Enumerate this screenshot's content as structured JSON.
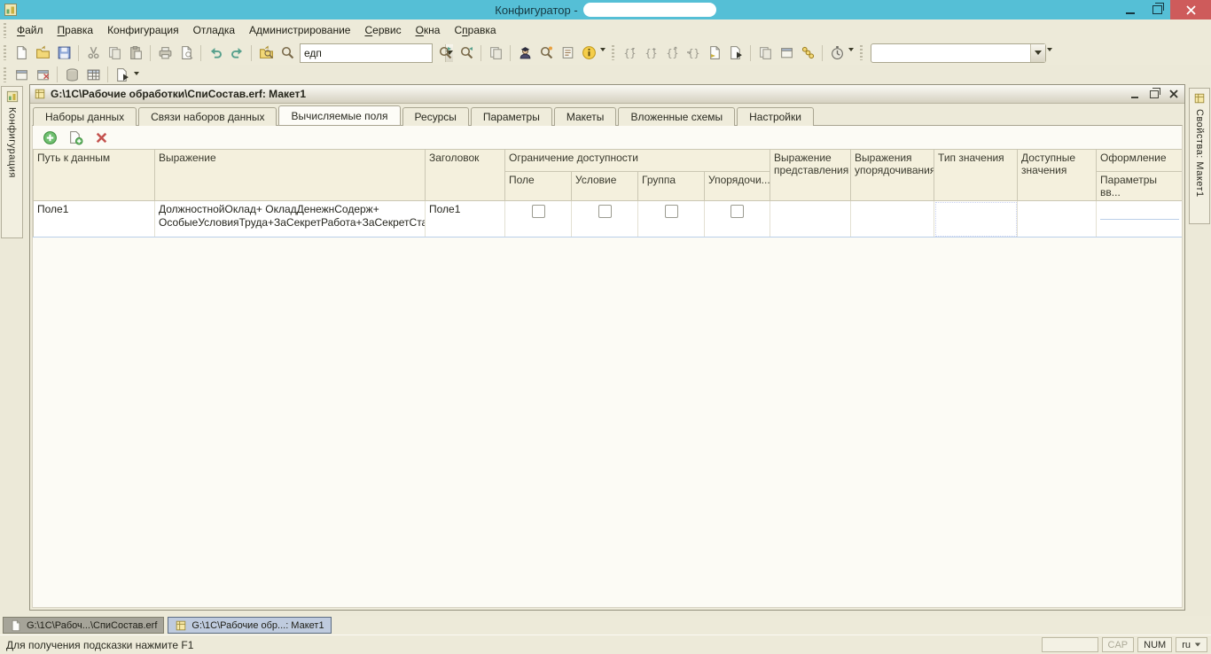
{
  "titlebar": {
    "title": "Конфигуратор -"
  },
  "menu": {
    "items": [
      {
        "label": "Файл",
        "accel": 0
      },
      {
        "label": "Правка",
        "accel": 0
      },
      {
        "label": "Конфигурация",
        "accel": -1
      },
      {
        "label": "Отладка",
        "accel": -1
      },
      {
        "label": "Администрирование",
        "accel": -1
      },
      {
        "label": "Сервис",
        "accel": 0
      },
      {
        "label": "Окна",
        "accel": 0
      },
      {
        "label": "Справка",
        "accel": 1
      }
    ]
  },
  "toolbar": {
    "search_value": "едп",
    "quick_select_value": "",
    "icons_row1": [
      "new-document",
      "open",
      "save",
      "cut",
      "copy",
      "paste",
      "print",
      "print-preview",
      "undo",
      "redo",
      "find-in-files",
      "search",
      "find-next",
      "find-previous",
      "clone-window",
      "syntax-check",
      "find-in-modules",
      "templates",
      "info",
      "step-braces-1",
      "step-braces-2",
      "step-braces-3",
      "step-braces-4",
      "page-import",
      "show-module",
      "copy-fragment",
      "properties-window",
      "chain-links",
      "stopwatch"
    ],
    "icons_row2": [
      "window-gray",
      "close-window",
      "database",
      "table",
      "module-run"
    ]
  },
  "panel_tabs": {
    "left": "Конфигурация",
    "right": "Свойства: Макет1"
  },
  "child_window": {
    "title": "G:\\1C\\Рабочие обработки\\СпиСостав.erf: Макет1",
    "tabs": [
      "Наборы данных",
      "Связи наборов данных",
      "Вычисляемые поля",
      "Ресурсы",
      "Параметры",
      "Макеты",
      "Вложенные схемы",
      "Настройки"
    ],
    "active_tab": "Вычисляемые поля",
    "inner_toolbar_icons": [
      "add",
      "add-copy",
      "delete"
    ]
  },
  "table": {
    "headers": {
      "path": "Путь к данным",
      "expression": "Выражение",
      "title": "Заголовок",
      "restriction": "Ограничение доступности",
      "restriction_field": "Поле",
      "restriction_condition": "Условие",
      "restriction_group": "Группа",
      "restriction_order": "Упорядочи...",
      "presentation": "Выражение представления",
      "ordering": "Выражения упорядочивания",
      "value_type": "Тип значения",
      "available": "Доступные значения",
      "appearance": "Оформление",
      "appearance_params": "Параметры вв..."
    },
    "row": {
      "path": "Поле1",
      "expression": [
        "ДолжностнойОклад+ ОкладДенежнСодерж+",
        "ОсобыеУсловияТруда+ЗаСекретРабота+ЗаСекретСта..."
      ],
      "title": "Поле1",
      "field_checked": false,
      "condition_checked": false,
      "group_checked": false,
      "order_checked": false,
      "selected_cell": "Тип значения"
    }
  },
  "bottom_tabs": [
    {
      "label": "G:\\1C\\Рабоч...\\СпиСостав.erf",
      "active": false
    },
    {
      "label": "G:\\1C\\Рабочие обр...: Макет1",
      "active": true
    }
  ],
  "statusbar": {
    "hint": "Для получения подсказки нажмите F1",
    "cap": "CAP",
    "num": "NUM",
    "lang": "ru"
  },
  "colors": {
    "titlebar": "#55BFD6",
    "close_button": "#CE5B5B",
    "selection": "#4C63B8",
    "chrome": "#ECE9D8"
  }
}
